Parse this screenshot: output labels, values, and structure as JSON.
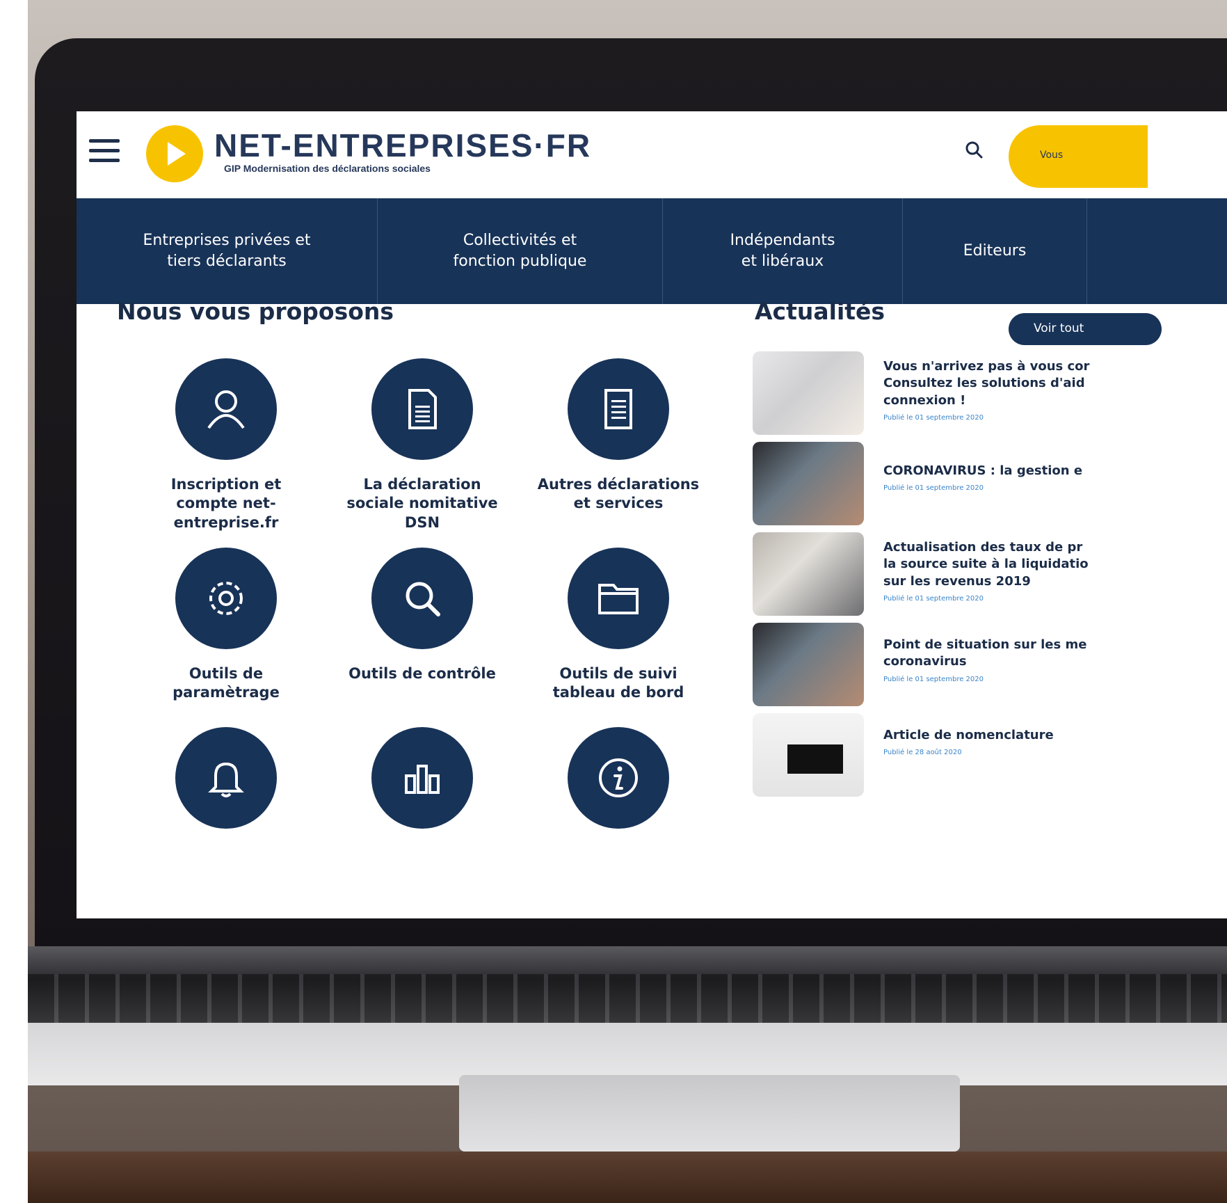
{
  "header": {
    "logo_title": "NET-ENTREPRISES·FR",
    "logo_subtitle": "GIP Modernisation des déclarations sociales",
    "account_label": "Vous"
  },
  "nav": [
    {
      "label": "Entreprises privées et\ntiers déclarants"
    },
    {
      "label": "Collectivités et\nfonction publique"
    },
    {
      "label": "Indépendants\net libéraux"
    },
    {
      "label": "Editeurs"
    },
    {
      "label": ""
    }
  ],
  "proposals": {
    "title": "Nous vous proposons",
    "items": [
      {
        "label": "Inscription et\ncompte net-\nentreprise.fr",
        "icon": "user-icon"
      },
      {
        "label": "La déclaration\nsociale nomitative\nDSN",
        "icon": "document-icon"
      },
      {
        "label": "Autres déclarations\net services",
        "icon": "document-icon"
      },
      {
        "label": "Outils de\nparamètrage",
        "icon": "gear-icon"
      },
      {
        "label": "Outils de contrôle",
        "icon": "search-icon"
      },
      {
        "label": "Outils de suivi\ntableau de bord",
        "icon": "folder-icon"
      },
      {
        "label": "",
        "icon": "bell-icon"
      },
      {
        "label": "",
        "icon": "bar-chart-icon"
      },
      {
        "label": "",
        "icon": "info-icon"
      }
    ]
  },
  "news": {
    "title": "Actualités",
    "see_all": "Voir tout",
    "items": [
      {
        "title": "Vous n'arrivez pas à vous cor\nConsultez les solutions d'aid\nconnexion !",
        "date": "Publié le 01 septembre 2020"
      },
      {
        "title": "CORONAVIRUS : la gestion e",
        "date": "Publié le 01 septembre 2020"
      },
      {
        "title": "Actualisation des taux de pr\nla source suite à la liquidatio\nsur les revenus 2019",
        "date": "Publié le 01 septembre 2020"
      },
      {
        "title": "Point de situation sur les me\ncoronavirus",
        "date": "Publié le 01 septembre 2020"
      },
      {
        "title": "Article de nomenclature",
        "date": "Publié le 28 août 2020"
      }
    ]
  },
  "colors": {
    "navy": "#183358",
    "yellow": "#f7c300",
    "text": "#1b2c48",
    "link": "#3a84c9"
  }
}
